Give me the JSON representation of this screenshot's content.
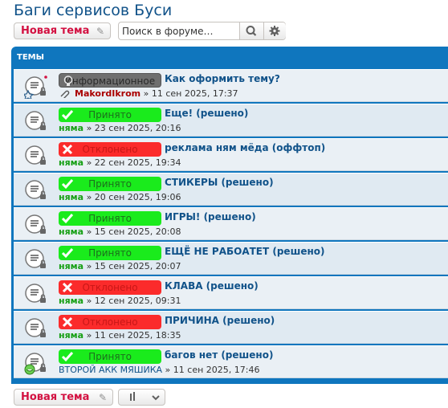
{
  "page": {
    "title": "Баги сервисов Буси"
  },
  "toolbar": {
    "new_topic_label": "Новая тема",
    "search_placeholder": "Поиск в форуме…"
  },
  "forum": {
    "header_label": "ТЕМЫ",
    "topics": [
      {
        "badge": "Информационное",
        "badge_type": "info",
        "title": "Как оформить тему?",
        "author": "MakordIkrom",
        "date": "» 11 сен 2025, 17:37"
      },
      {
        "badge": "Принято",
        "badge_type": "ok",
        "title": "Еще! (решено)",
        "author": "няма",
        "date": "» 23 сен 2025, 20:16"
      },
      {
        "badge": "Отклонено",
        "badge_type": "rej",
        "title": "реклама ням мёда (оффтоп)",
        "author": "няма",
        "date": "» 22 сен 2025, 19:34"
      },
      {
        "badge": "Принято",
        "badge_type": "ok",
        "title": "СТИКЕРЫ (решено)",
        "author": "няма",
        "date": "» 20 сен 2025, 19:06"
      },
      {
        "badge": "Принято",
        "badge_type": "ok",
        "title": "ИГРЫ! (решено)",
        "author": "няма",
        "date": "» 15 сен 2025, 20:08"
      },
      {
        "badge": "Принято",
        "badge_type": "ok",
        "title": "ЕЩЁ НЕ РАБОАТЕТ (решено)",
        "author": "няма",
        "date": "» 15 сен 2025, 20:07"
      },
      {
        "badge": "Отклонено",
        "badge_type": "rej",
        "title": "КЛАВА (решено)",
        "author": "няма",
        "date": "» 12 сен 2025, 09:31"
      },
      {
        "badge": "Отклонено",
        "badge_type": "rej",
        "title": "ПРИЧИНА (решено)",
        "author": "няма",
        "date": "» 11 сен 2025, 18:35"
      },
      {
        "badge": "Принято",
        "badge_type": "ok",
        "title": "багов нет (решено)",
        "author": "ВТОРОЙ АКК МЯШИКА",
        "date": "» 11 сен 2025, 17:46"
      }
    ]
  },
  "bottom": {
    "new_topic_label": "Новая тема"
  },
  "colors": {
    "accent": "#105289",
    "header_bg": "#0f76be",
    "new_topic": "#d31141",
    "accepted": "#1aeb1c",
    "rejected": "#fb2b2b"
  }
}
